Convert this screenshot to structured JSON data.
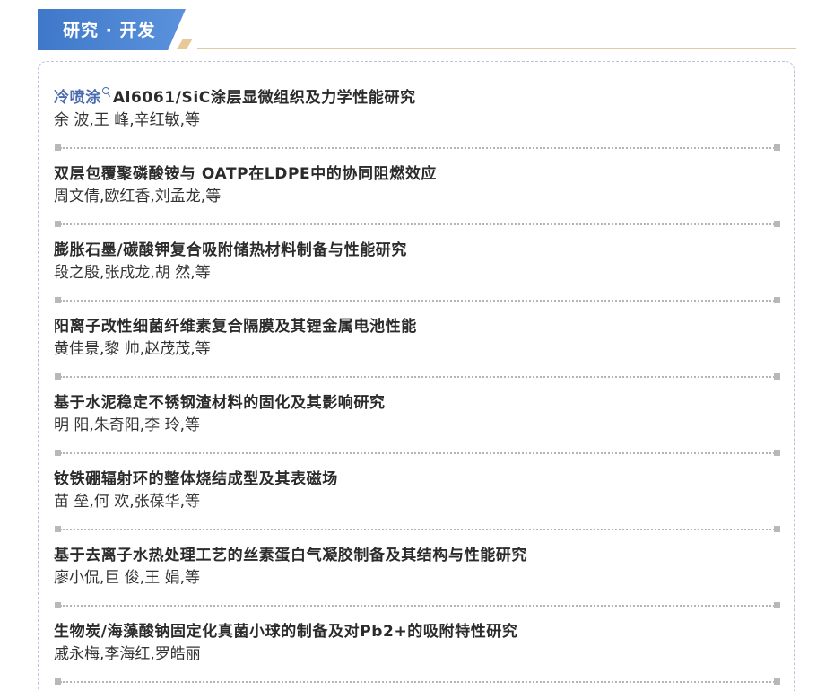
{
  "section": {
    "title": "研究 · 开发"
  },
  "articles": [
    {
      "title_highlight": "冷喷涂",
      "title": "Al6061/SiC涂层显微组织及力学性能研究",
      "authors": "余 波,王 峰,辛红敏,等"
    },
    {
      "title_highlight": "",
      "title": "双层包覆聚磷酸铵与 OATP在LDPE中的协同阻燃效应",
      "authors": "周文倩,欧红香,刘孟龙,等"
    },
    {
      "title_highlight": "",
      "title": "膨胀石墨/碳酸钾复合吸附储热材料制备与性能研究",
      "authors": "段之殷,张成龙,胡 然,等"
    },
    {
      "title_highlight": "",
      "title": "阳离子改性细菌纤维素复合隔膜及其锂金属电池性能",
      "authors": "黄佳景,黎 帅,赵茂茂,等"
    },
    {
      "title_highlight": "",
      "title": "基于水泥稳定不锈钢渣材料的固化及其影响研究",
      "authors": "明 阳,朱奇阳,李 玲,等"
    },
    {
      "title_highlight": "",
      "title": "钕铁硼辐射环的整体烧结成型及其表磁场",
      "authors": "苗 垒,何 欢,张葆华,等"
    },
    {
      "title_highlight": "",
      "title": "基于去离子水热处理工艺的丝素蛋白气凝胶制备及其结构与性能研究",
      "authors": "廖小侃,巨 俊,王 娟,等"
    },
    {
      "title_highlight": "",
      "title": "生物炭/海藻酸钠固定化真菌小球的制备及对Pb2+的吸附特性研究",
      "authors": "戚永梅,李海红,罗皓丽"
    }
  ]
}
